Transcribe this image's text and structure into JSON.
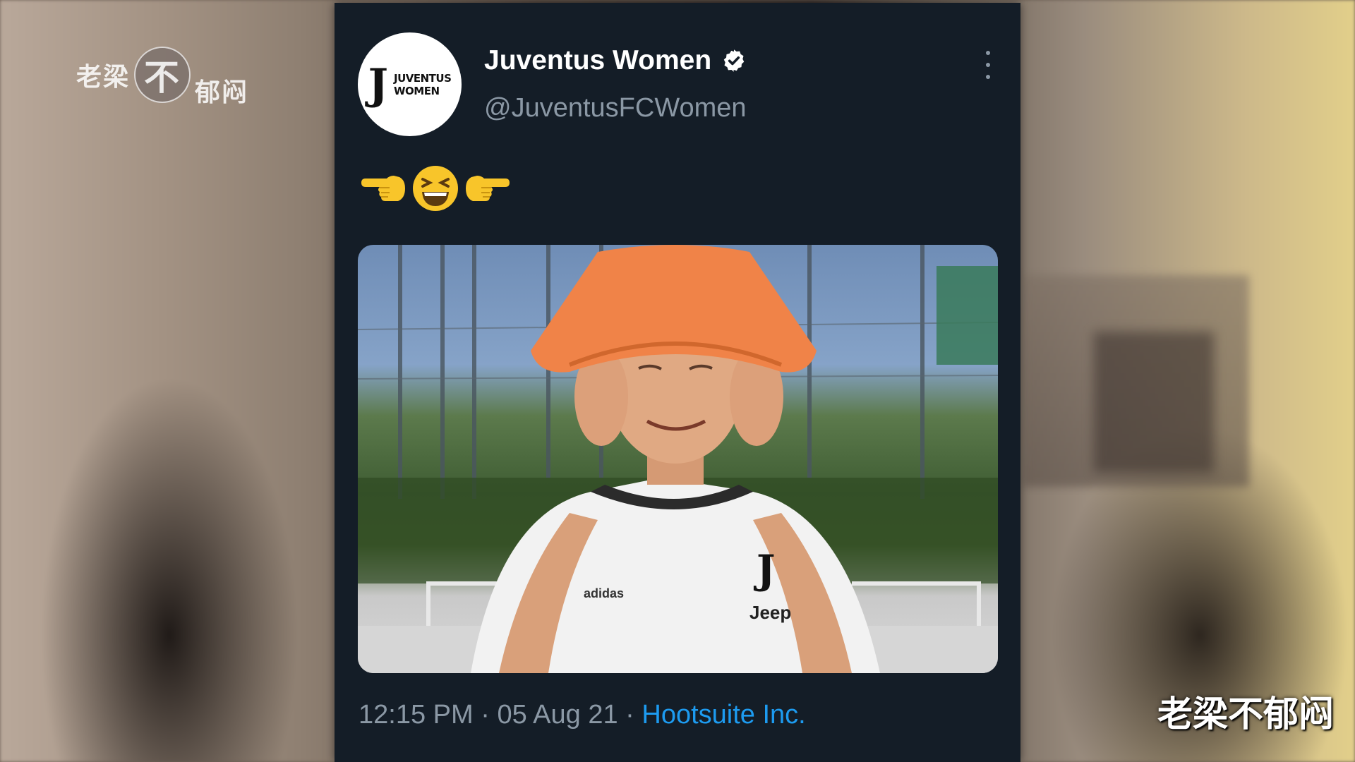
{
  "watermark": {
    "top_left_a": "老梁",
    "top_left_circle": "不",
    "top_left_b": "郁闷",
    "bottom_right": "老梁不郁闷"
  },
  "tweet": {
    "avatar": {
      "logo_letter": "J",
      "logo_line1": "JUVENTUS",
      "logo_line2": "WOMEN"
    },
    "display_name": "Juventus Women",
    "verified_icon": "verified-badge-icon",
    "handle": "@JuventusFCWomen",
    "more_icon": "more-options-icon",
    "text_emojis": [
      "point-left-emoji",
      "laughing-face-emoji",
      "point-right-emoji"
    ],
    "media": {
      "description_icon": "photo",
      "jersey_sponsor": "Jeep",
      "jersey_brand": "adidas"
    },
    "time": "12:15 PM",
    "separator": "·",
    "date": "05 Aug 21",
    "source": "Hootsuite Inc."
  },
  "colors": {
    "card_bg": "#141d27",
    "link": "#1d9bf0",
    "muted": "#8b98a5",
    "verified_badge": "#ffffff"
  }
}
